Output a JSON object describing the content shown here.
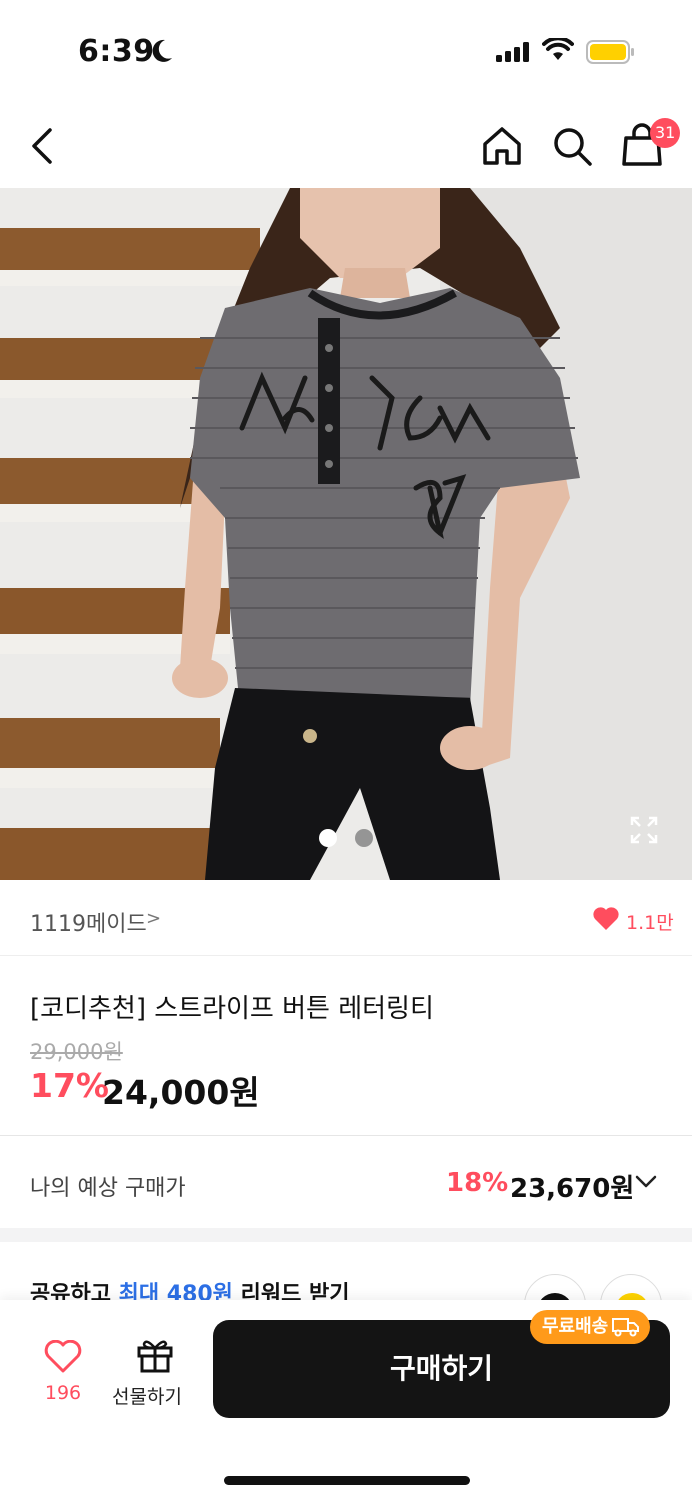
{
  "status_bar": {
    "time": "6:39"
  },
  "nav": {
    "cart_badge": "31"
  },
  "hero": {
    "current_image": 1,
    "total_images": 2
  },
  "brand": {
    "name": "1119메이드",
    "arrow": ">",
    "likes": "1.1만"
  },
  "product": {
    "title": "[코디추천] 스트라이프 버튼 레터링티",
    "original_price": "29,000원",
    "discount": "17%",
    "price": "24,000원"
  },
  "expected_price": {
    "label": "나의 예상 구매가",
    "discount": "18%",
    "price": "23,670원"
  },
  "share": {
    "prefix": "공유하고 ",
    "highlight": "최대 480원",
    "suffix": " 리워드 받기"
  },
  "bottom": {
    "wishlist_count": "196",
    "gift_label": "선물하기",
    "buy_label": "구매하기",
    "free_shipping_label": "무료배송"
  },
  "colors": {
    "accent": "#ff4d5e",
    "highlight_blue": "#2c6fe5",
    "badge_orange": "#ff9a1a"
  }
}
